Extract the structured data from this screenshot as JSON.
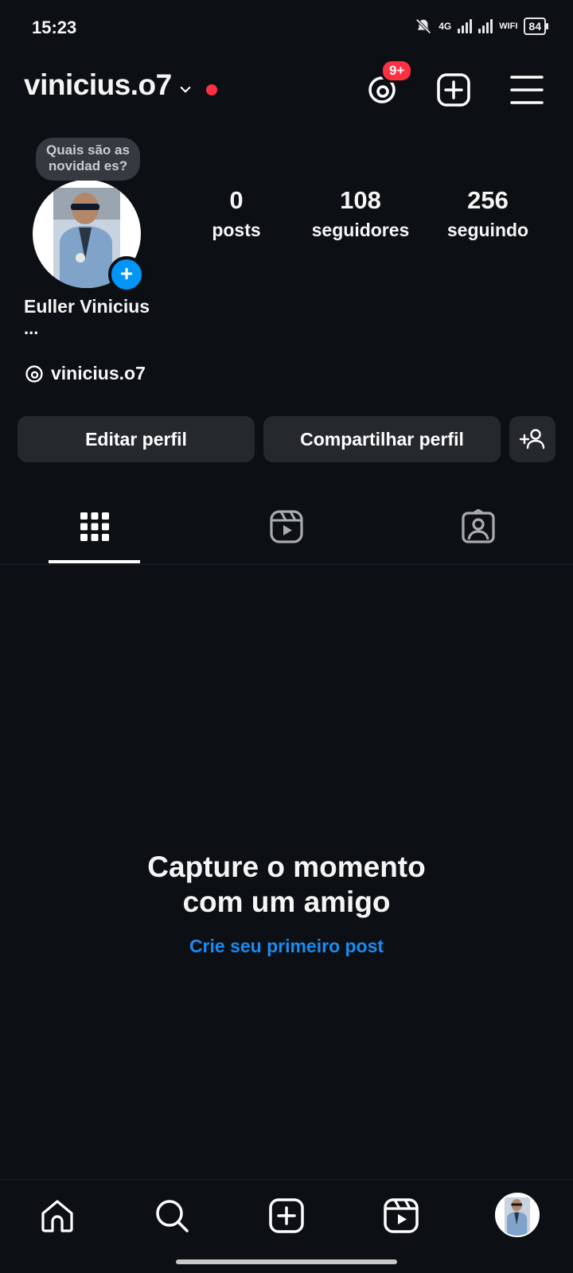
{
  "status_bar": {
    "time": "15:23",
    "network": "4G",
    "wifi_label": "WIFI",
    "battery": "84"
  },
  "header": {
    "username": "vinicius.o7",
    "threads_badge": "9+",
    "icons": [
      "chevron-down-icon",
      "threads-icon",
      "add-square-icon",
      "hamburger-menu-icon"
    ]
  },
  "profile": {
    "note": "Quais são as novidad es?",
    "stats": [
      {
        "value": "0",
        "label": "posts"
      },
      {
        "value": "108",
        "label": "seguidores"
      },
      {
        "value": "256",
        "label": "seguindo"
      }
    ],
    "full_name": "Euller Vinicius",
    "bio_more": "...",
    "threads_handle": "vinicius.o7"
  },
  "actions": {
    "edit_profile": "Editar perfil",
    "share_profile": "Compartilhar perfil"
  },
  "tabs": [
    "grid-icon",
    "reels-icon",
    "tagged-icon"
  ],
  "empty_state": {
    "title_line1": "Capture o momento",
    "title_line2": "com um amigo",
    "link": "Crie seu primeiro post"
  },
  "bottom_nav": [
    "home-icon",
    "search-icon",
    "create-icon",
    "reels-icon",
    "profile-avatar"
  ],
  "colors": {
    "background": "#0c0f14",
    "accent": "#0095f6",
    "link": "#1a8cf0",
    "notification": "#ff3040",
    "button": "#25292e"
  }
}
